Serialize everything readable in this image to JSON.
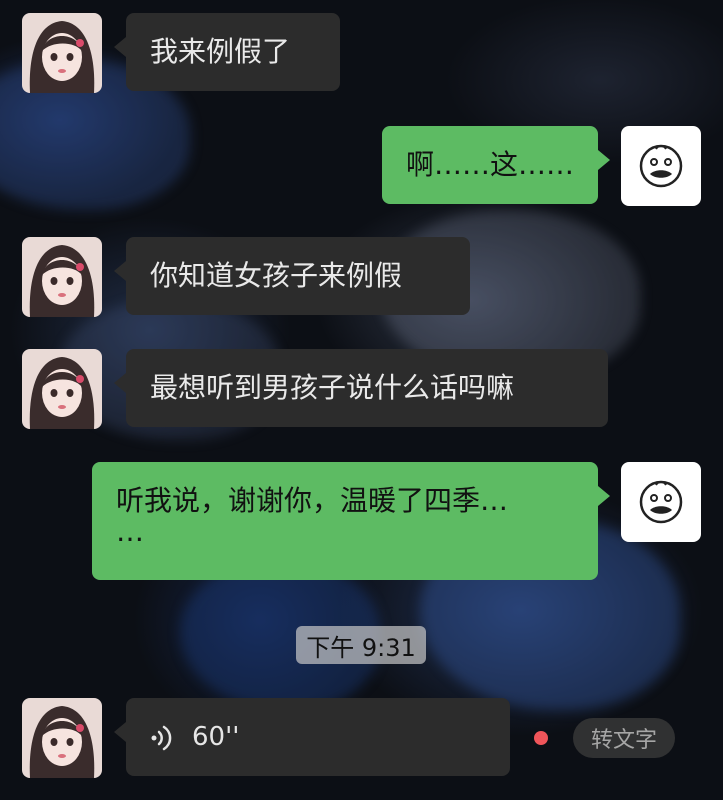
{
  "messages": [
    {
      "text": "我来例假了"
    },
    {
      "text": "啊……这……"
    },
    {
      "text": "你知道女孩子来例假"
    },
    {
      "text": "最想听到男孩子说什么话吗嘛"
    },
    {
      "text_line1": "听我说，谢谢你，温暖了四季…",
      "text_line2": "…"
    }
  ],
  "timestamp": "下午 9:31",
  "voice": {
    "duration": "60''",
    "convert_label": "转文字"
  },
  "colors": {
    "incoming_bubble": "#2c2c2c",
    "outgoing_bubble": "#5dbb63",
    "unread_dot": "#f0555a"
  }
}
